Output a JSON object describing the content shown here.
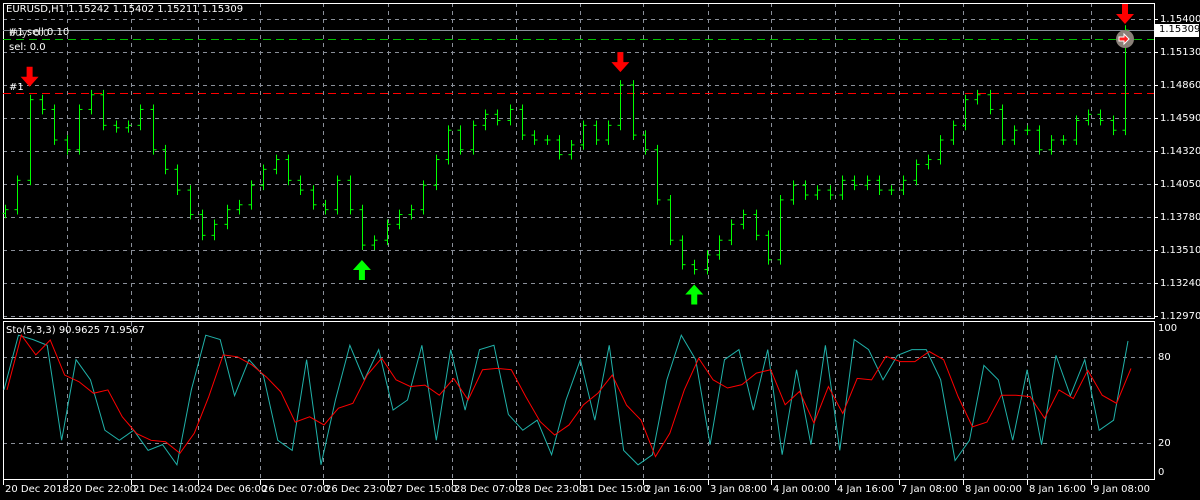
{
  "header": {
    "symbol_info": "EURUSD,H1  1.15242 1.15402 1.15211 1.15309",
    "order_line_1": "#1 sell 0.10",
    "order_line_1_overlap": "buy: 0.0",
    "order_line_2": "sel: 0.0",
    "order_marker": "#1"
  },
  "colors": {
    "background": "#000000",
    "bars": "#00ff00",
    "grid": "#8a8f99",
    "signal_up": "#00ff00",
    "signal_down": "#ff0000",
    "stoch_main": "#20b2aa",
    "stoch_signal": "#ff0000",
    "order_line": "#ff0000",
    "tp_line": "#00c000",
    "price_line": "#8a8f99"
  },
  "chart_data": [
    {
      "type": "ohlc",
      "title": "EURUSD,H1",
      "current_price": "1.15309",
      "ylim": [
        1.1297,
        1.154
      ],
      "y_ticks": [
        "1.15400",
        "1.15130",
        "1.14860",
        "1.14590",
        "1.14320",
        "1.14050",
        "1.13780",
        "1.13510",
        "1.13240",
        "1.12970"
      ],
      "x_ticks": [
        "20 Dec 2018",
        "20 Dec 22:00",
        "21 Dec 14:00",
        "24 Dec 06:00",
        "26 Dec 07:00",
        "26 Dec 23:00",
        "27 Dec 15:00",
        "28 Dec 07:00",
        "28 Dec 23:00",
        "31 Dec 15:00",
        "2 Jan 16:00",
        "3 Jan 08:00",
        "4 Jan 00:00",
        "4 Jan 16:00",
        "7 Jan 08:00",
        "8 Jan 00:00",
        "8 Jan 16:00",
        "9 Jan 08:00"
      ],
      "closes": [
        1.1384,
        1.1408,
        1.1474,
        1.1466,
        1.1441,
        1.1433,
        1.1466,
        1.1478,
        1.1453,
        1.1451,
        1.1453,
        1.1466,
        1.1433,
        1.1417,
        1.14,
        1.138,
        1.1363,
        1.1372,
        1.1384,
        1.1388,
        1.1404,
        1.1417,
        1.1425,
        1.1408,
        1.14,
        1.1388,
        1.1384,
        1.1408,
        1.1384,
        1.1355,
        1.1359,
        1.1372,
        1.138,
        1.1384,
        1.1404,
        1.1425,
        1.1449,
        1.1433,
        1.1453,
        1.1462,
        1.1457,
        1.1466,
        1.1445,
        1.1441,
        1.1441,
        1.1429,
        1.1437,
        1.1453,
        1.1441,
        1.1453,
        1.1486,
        1.1445,
        1.1433,
        1.1392,
        1.1359,
        1.1339,
        1.1335,
        1.1347,
        1.1359,
        1.1372,
        1.138,
        1.1363,
        1.1343,
        1.1392,
        1.1404,
        1.1396,
        1.14,
        1.1396,
        1.1408,
        1.1404,
        1.1408,
        1.14,
        1.14,
        1.1408,
        1.1421,
        1.1425,
        1.1441,
        1.1453,
        1.1474,
        1.1478,
        1.1466,
        1.1441,
        1.1449,
        1.1449,
        1.1433,
        1.1441,
        1.1441,
        1.1457,
        1.1462,
        1.1457,
        1.1449,
        1.15309
      ],
      "sell_arrows_at_close_index": [
        2,
        50,
        91
      ],
      "buy_arrows_at_close_index": [
        29,
        56
      ]
    },
    {
      "type": "line",
      "title": "Sto(5,3,3) 90.9625 71.9567",
      "ylim": [
        0,
        100
      ],
      "y_ticks": [
        "100",
        "80",
        "20",
        "0"
      ],
      "levels": [
        80,
        20
      ],
      "series": [
        {
          "name": "main",
          "values": [
            57,
            95,
            92,
            88,
            22,
            78,
            64,
            29,
            22,
            29,
            15,
            19,
            5,
            57,
            95,
            92,
            53,
            78,
            67,
            22,
            15,
            78,
            5,
            50,
            88,
            64,
            85,
            43,
            50,
            88,
            22,
            85,
            43,
            85,
            88,
            40,
            29,
            36,
            12,
            50,
            78,
            36,
            88,
            15,
            5,
            12,
            64,
            95,
            78,
            19,
            78,
            85,
            43,
            85,
            12,
            71,
            19,
            88,
            15,
            92,
            85,
            64,
            81,
            85,
            85,
            64,
            8,
            22,
            74,
            64,
            22,
            71,
            19,
            81,
            53,
            78,
            29,
            36,
            90.9625
          ]
        },
        {
          "name": "signal",
          "smoothing": "SMA 3 of main",
          "last_value": 71.9567
        }
      ]
    }
  ]
}
